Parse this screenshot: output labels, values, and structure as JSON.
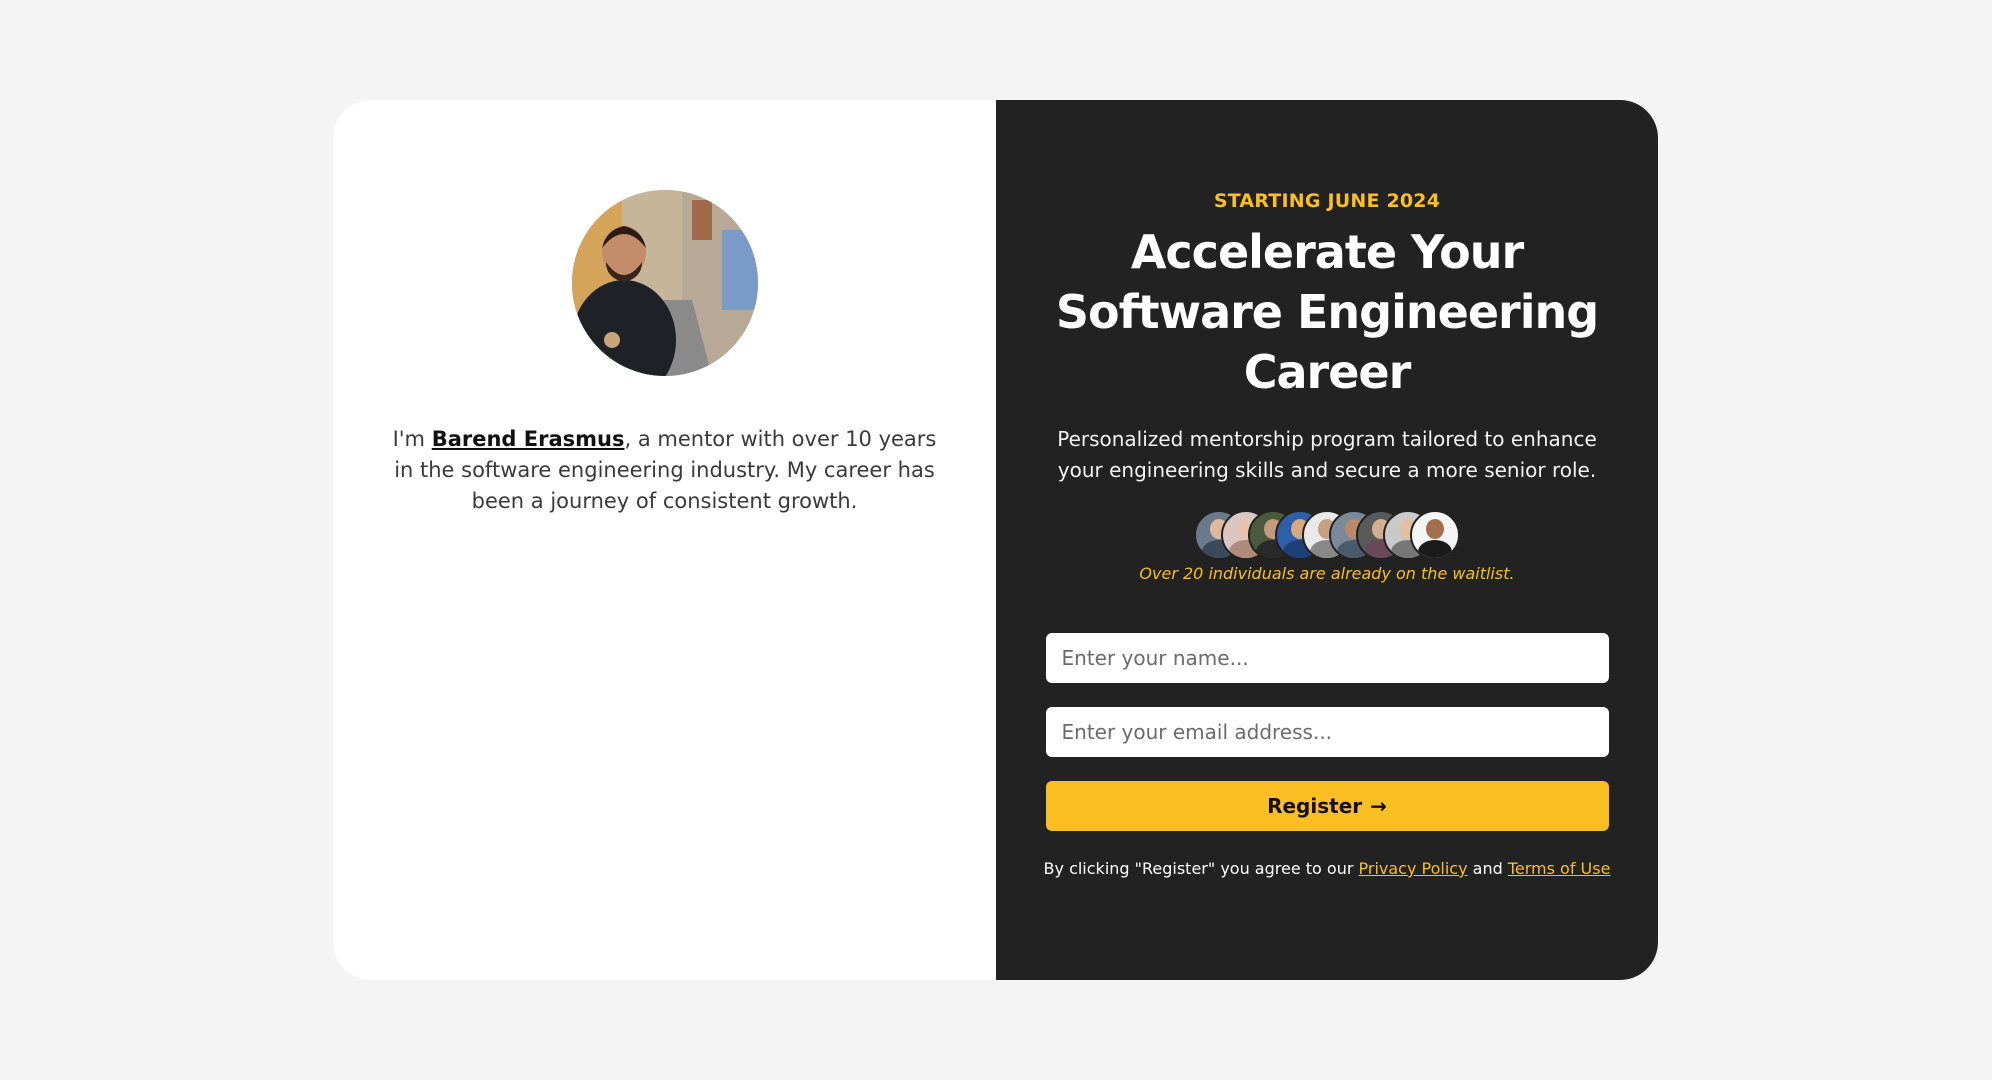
{
  "mentor": {
    "bio_prefix": "I'm ",
    "name": "Barend Erasmus",
    "bio_suffix": ", a mentor with over 10 years in the software engineering industry. My career has been a journey of consistent growth."
  },
  "hero": {
    "eyebrow": "STARTING JUNE 2024",
    "headline": "Accelerate Your Software Engineering Career",
    "subhead": "Personalized mentorship program tailored to enhance your engineering skills and secure a more senior role.",
    "waitlist_text": "Over 20 individuals are already on the waitlist."
  },
  "waitlist_avatars": [
    {
      "bg": "#6b7a8a",
      "head": "#e0b99a",
      "body": "#3b4a5a"
    },
    {
      "bg": "#d9c7c2",
      "head": "#e8c4b0",
      "body": "#b08a7a"
    },
    {
      "bg": "#4b5a3a",
      "head": "#c49a7a",
      "body": "#2a2a2a"
    },
    {
      "bg": "#2f5fa8",
      "head": "#d7a982",
      "body": "#1f3f78"
    },
    {
      "bg": "#e9e9e9",
      "head": "#c8a080",
      "body": "#888888"
    },
    {
      "bg": "#7a8a9a",
      "head": "#b88a6a",
      "body": "#4a5a6a"
    },
    {
      "bg": "#5a5a5a",
      "head": "#d0b090",
      "body": "#6a4a5a"
    },
    {
      "bg": "#c9c9c9",
      "head": "#e0c0a0",
      "body": "#777777"
    },
    {
      "bg": "#f5f5f5",
      "head": "#a07050",
      "body": "#1a1a1a"
    }
  ],
  "form": {
    "name_placeholder": "Enter your name...",
    "email_placeholder": "Enter your email address...",
    "register_label": "Register",
    "register_arrow": "→"
  },
  "legal": {
    "prefix": "By clicking \"Register\" you agree to our ",
    "privacy": "Privacy Policy",
    "and": " and ",
    "terms": "Terms of Use"
  },
  "colors": {
    "accent": "#fbbf24",
    "dark_panel": "#222222",
    "page_bg": "#f4f4f4"
  }
}
